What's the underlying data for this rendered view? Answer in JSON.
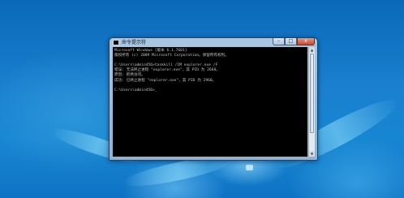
{
  "window": {
    "title": "命令提示符",
    "controls": {
      "minimize": "–",
      "maximize": "□",
      "close": "x"
    }
  },
  "console": {
    "lines": [
      "Microsoft Windows [版本 6.1.7601]",
      "版权所有 (c) 2009 Microsoft Corporation。保留所有权利。",
      "",
      "C:\\Users\\admin456>taskkill /IM explorer.exe /F",
      "错误: 无法终止进程 \"explorer.exe\"，其 PID 为 2668。",
      "原因: 拒绝访问。",
      "成功: 已终止进程 \"explorer.exe\"，其 PID 为 2960。",
      "",
      "C:\\Users\\admin456>_"
    ]
  },
  "scrollbar": {
    "up_arrow": "▲",
    "down_arrow": "▼"
  }
}
